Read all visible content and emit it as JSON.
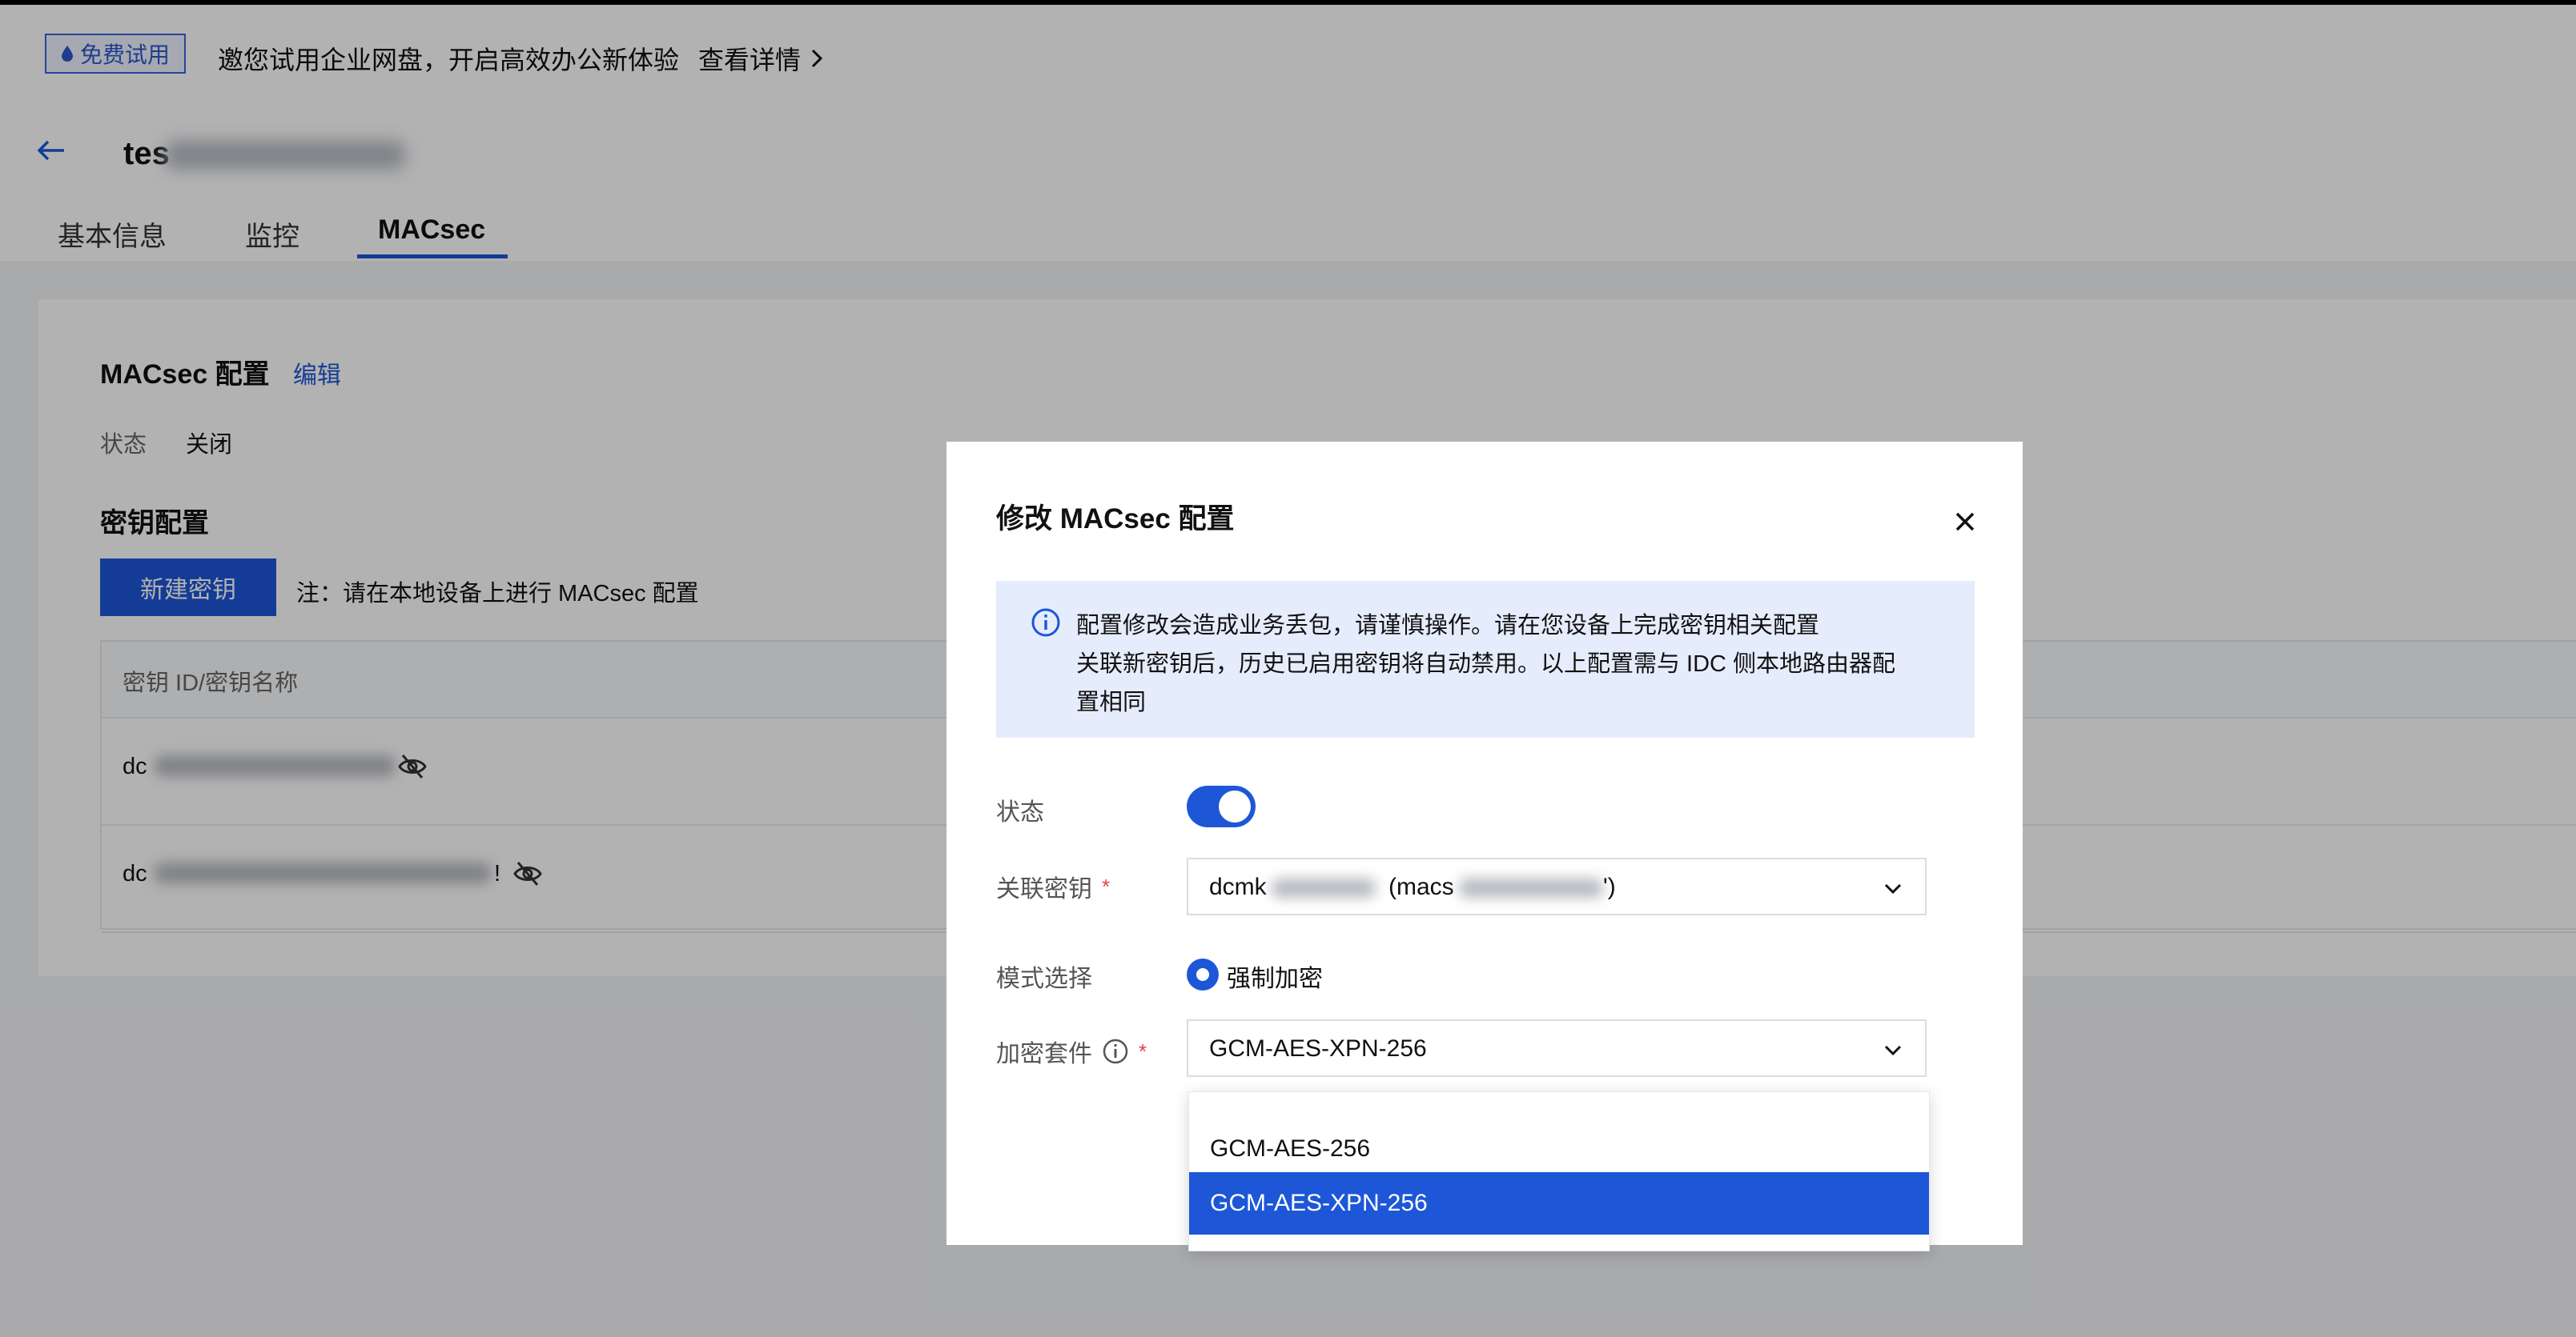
{
  "banner": {
    "badge": "免费试用",
    "text": "邀您试用企业网盘，开启高效办公新体验",
    "link": "查看详情"
  },
  "header": {
    "title_prefix": "tes",
    "tabs": [
      "基本信息",
      "监控",
      "MACsec"
    ],
    "active_tab": "MACsec"
  },
  "macsec_section": {
    "title": "MACsec 配置",
    "edit": "编辑",
    "status_label": "状态",
    "status_value": "关闭"
  },
  "key_section": {
    "title": "密钥配置",
    "new_key_button": "新建密钥",
    "note": "注：请在本地设备上进行 MACsec 配置",
    "table_header": "密钥 ID/密钥名称",
    "rows": [
      {
        "prefix": "dc"
      },
      {
        "prefix": "dc",
        "suffix": "!"
      }
    ]
  },
  "modal": {
    "title": "修改 MACsec 配置",
    "alert_lines": [
      "配置修改会造成业务丢包，请谨慎操作。请在您设备上完成密钥相关配置",
      "关联新密钥后，历史已启用密钥将自动禁用。以上配置需与 IDC 侧本地路由器配",
      "置相同"
    ],
    "status_label": "状态",
    "status_on": true,
    "key_label": "关联密钥",
    "key_value_prefix": "dcmk",
    "key_value_mid": "(macs",
    "key_value_suffix": "')",
    "mode_label": "模式选择",
    "mode_value": "强制加密",
    "cipher_label": "加密套件",
    "cipher_value": "GCM-AES-XPN-256",
    "cipher_options": [
      "GCM-AES-256",
      "GCM-AES-XPN-256"
    ],
    "cipher_selected_index": 1
  },
  "colors": {
    "primary": "#1d57d7",
    "alert_bg": "#e5ecfc",
    "required": "#e54545"
  }
}
